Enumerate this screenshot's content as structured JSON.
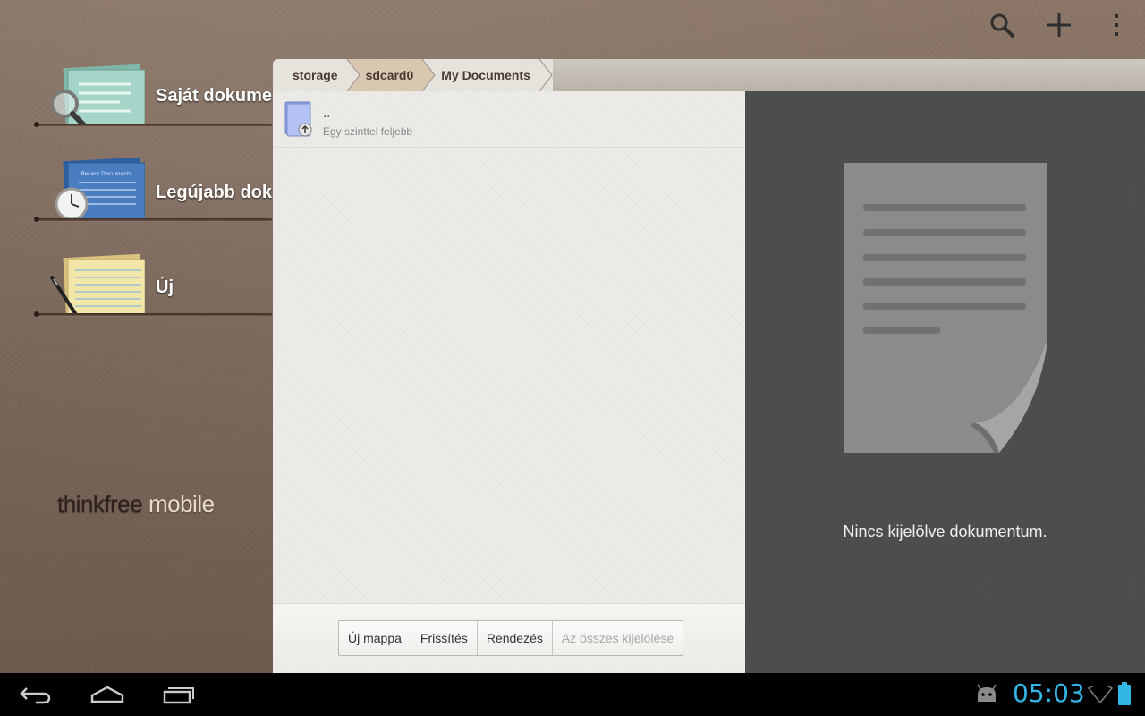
{
  "action_bar": {
    "icons": [
      "search-icon",
      "plus-icon",
      "overflow-menu-icon"
    ]
  },
  "shelf": {
    "items": [
      {
        "label": "Saját dokume",
        "icon": "my-documents-icon"
      },
      {
        "label": "Legújabb doku",
        "icon": "recent-documents-icon"
      },
      {
        "label": "Új",
        "icon": "new-document-icon"
      }
    ],
    "recent_thumb_text": "Recent Documents"
  },
  "brand": {
    "part1": "thinkfree",
    "part2": " mobile"
  },
  "breadcrumb": {
    "items": [
      "storage",
      "sdcard0",
      "My Documents"
    ]
  },
  "file_list": {
    "rows": [
      {
        "name": "..",
        "subtitle": "Egy szinttel feljebb",
        "icon": "folder-up-icon"
      }
    ]
  },
  "toolbar": {
    "new_folder": "Új mappa",
    "refresh": "Frissítés",
    "sort": "Rendezés",
    "select_all": "Az összes kijelölése"
  },
  "preview": {
    "message": "Nincs kijelölve dokumentum.",
    "icon": "document-placeholder-icon"
  },
  "system_bar": {
    "clock": "05:03",
    "nav_icons": [
      "back-icon",
      "home-icon",
      "recent-apps-icon"
    ],
    "status_icons": [
      "android-debug-icon",
      "wifi-icon",
      "battery-icon"
    ],
    "clock_color": "#33b5e5"
  },
  "colors": {
    "leather": "#7a6659",
    "file_panel": "#ecebe7",
    "preview_bg": "#4b4c4b"
  }
}
